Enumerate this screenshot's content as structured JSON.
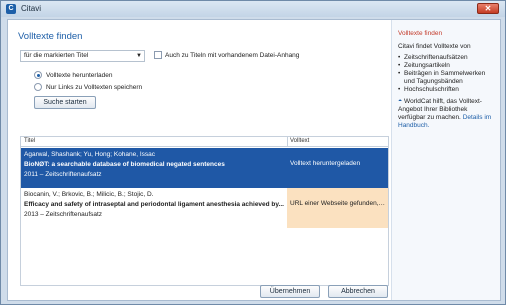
{
  "window": {
    "title": "Citavi"
  },
  "dialog": {
    "heading": "Volltexte finden",
    "scope_select": "für die markierten Titel",
    "checkbox_label": "Auch zu Titeln mit vorhandenem Datei-Anhang",
    "radio_download": "Volltexte herunterladen",
    "radio_links": "Nur Links zu Volltexten speichern",
    "start_button": "Suche starten"
  },
  "table": {
    "columns": [
      "Titel",
      "Volltext"
    ],
    "rows": [
      {
        "authors": "Agarwal, Shashank; Yu, Hong; Kohane, Issac",
        "title": "BioNØT: a searchable database of biomedical negated sentences",
        "meta": "2011 – Zeitschriftenaufsatz",
        "status": "Volltext heruntergeladen"
      },
      {
        "authors": "Biocanin, V.; Brkovic, B.; Milicic, B.; Stojic, D.",
        "title": "Efficacy and safety of intraseptal and periodontal ligament anesthesia achieved by...",
        "meta": "2013 – Zeitschriftenaufsatz",
        "status": "URL einer Webseite gefunden, v..."
      }
    ]
  },
  "footer": {
    "ok_button": "Übernehmen",
    "cancel_button": "Abbrechen"
  },
  "sidebar": {
    "title": "Volltexte finden",
    "intro": "Citavi findet Volltexte von",
    "items": [
      "Zeitschriftenaufsätzen",
      "Zeitungsartikeln",
      "Beiträgen in Sammelwerken und Tagungsbänden",
      "Hochschulschriften"
    ],
    "worldcat_text": "WorldCat hilft, das Volltext-Angebot Ihrer Bibliothek verfügbar zu machen.",
    "details_link": "Details im Handbuch."
  }
}
